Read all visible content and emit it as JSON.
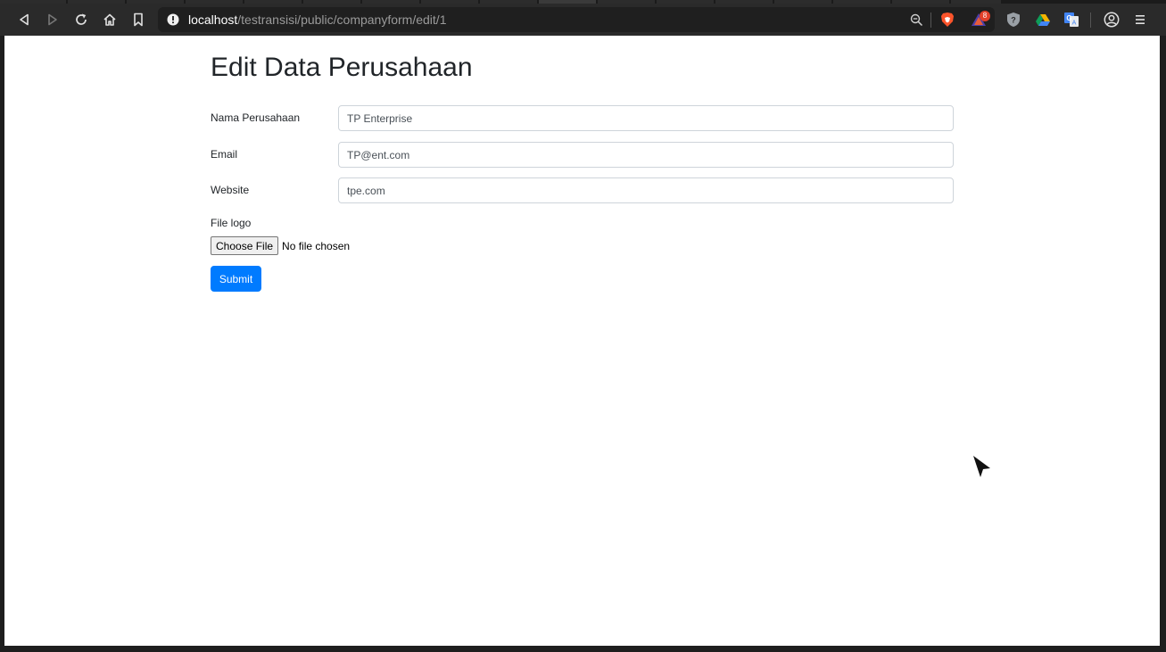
{
  "browser": {
    "url_host": "localhost",
    "url_path": "/testransisi/public/companyform/edit/1",
    "shield_badge": "8",
    "colors": {
      "toolbar": "#2a2a2a",
      "urlbar": "#1f1f1f",
      "brave_orange": "#fb542b"
    }
  },
  "page": {
    "title": "Edit Data Perusahaan",
    "fields": [
      {
        "label": "Nama Perusahaan",
        "value": "TP Enterprise"
      },
      {
        "label": "Email",
        "value": "TP@ent.com"
      },
      {
        "label": "Website",
        "value": "tpe.com"
      }
    ],
    "file": {
      "label": "File logo",
      "button_label": "Choose File",
      "status": "No file chosen"
    },
    "submit_label": "Submit",
    "colors": {
      "primary": "#007bff",
      "text": "#212529"
    }
  }
}
